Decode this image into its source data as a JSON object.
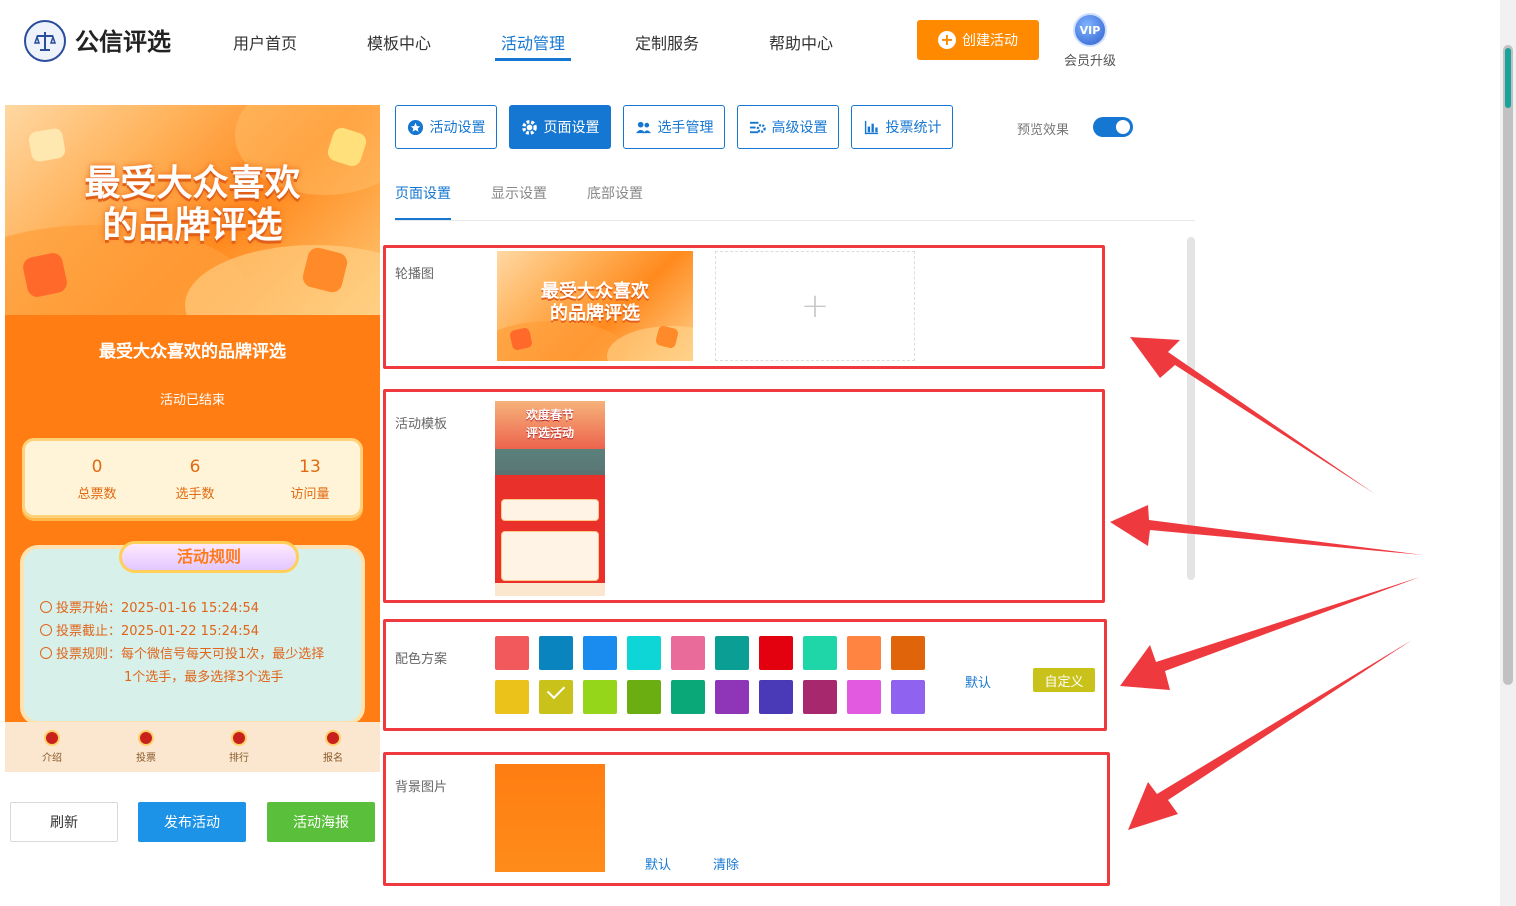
{
  "brand": {
    "name": "公信评选"
  },
  "nav": {
    "items": [
      {
        "label": "用户首页"
      },
      {
        "label": "模板中心"
      },
      {
        "label": "活动管理"
      },
      {
        "label": "定制服务"
      },
      {
        "label": "帮助中心"
      }
    ],
    "active_index": 2
  },
  "header": {
    "create_label": "创建活动",
    "vip_badge": "VIP",
    "vip_label": "会员升级"
  },
  "preview": {
    "banner_title_line1": "最受大众喜欢",
    "banner_title_line2": "的品牌评选",
    "activity_title": "最受大众喜欢的品牌评选",
    "status": "活动已结束",
    "stats": [
      {
        "value": "0",
        "label": "总票数"
      },
      {
        "value": "6",
        "label": "选手数"
      },
      {
        "value": "13",
        "label": "访问量"
      }
    ],
    "rules_title": "活动规则",
    "rules": {
      "start": "投票开始：2025-01-16 15:24:54",
      "end": "投票截止：2025-01-22 15:24:54",
      "rule_line1": "投票规则：每个微信号每天可投1次，最少选择",
      "rule_line2": "1个选手，最多选择3个选手"
    },
    "tabs": [
      "介绍",
      "投票",
      "排行",
      "报名"
    ]
  },
  "actions": {
    "refresh": "刷新",
    "publish": "发布活动",
    "poster": "活动海报"
  },
  "toolbar": {
    "buttons": [
      {
        "label": "活动设置",
        "icon": "star-icon"
      },
      {
        "label": "页面设置",
        "icon": "gear-icon"
      },
      {
        "label": "选手管理",
        "icon": "users-icon"
      },
      {
        "label": "高级设置",
        "icon": "settings-sliders-icon"
      },
      {
        "label": "投票统计",
        "icon": "bar-chart-icon"
      }
    ],
    "active_index": 1,
    "preview_label": "预览效果",
    "preview_on": true
  },
  "subtabs": {
    "items": [
      "页面设置",
      "显示设置",
      "底部设置"
    ],
    "active_index": 0
  },
  "sections": {
    "carousel": {
      "label": "轮播图",
      "thumb_line1": "最受大众喜欢",
      "thumb_line2": "的品牌评选"
    },
    "template": {
      "label": "活动模板",
      "thumb_line1": "欢度春节",
      "thumb_line2": "评选活动"
    },
    "colors": {
      "label": "配色方案",
      "palette_row1": [
        "#f2595c",
        "#0a84be",
        "#1a8cf0",
        "#0ed6d6",
        "#e86b9a",
        "#0a9e95",
        "#e3000f",
        "#1fd6a8",
        "#ff8442",
        "#e0650a"
      ],
      "palette_row2": [
        "#ebc21a",
        "#c9c21a",
        "#95d61a",
        "#6bae12",
        "#0aa878",
        "#8e35b8",
        "#4a3ab8",
        "#a8286e",
        "#e25ae0",
        "#9062f0"
      ],
      "selected": "#c9c21a",
      "default_label": "默认",
      "custom_label": "自定义"
    },
    "background": {
      "label": "背景图片",
      "default_label": "默认",
      "clear_label": "清除"
    }
  }
}
